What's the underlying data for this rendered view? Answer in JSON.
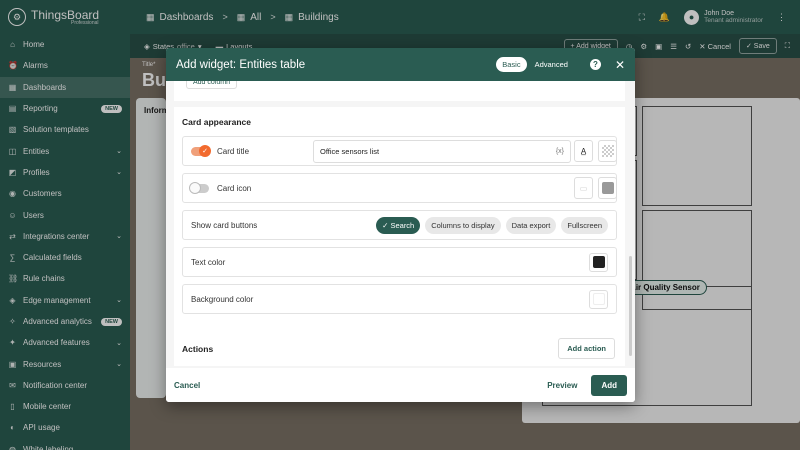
{
  "app": {
    "name": "ThingsBoard",
    "edition": "Professional"
  },
  "breadcrumb": [
    {
      "label": "Dashboards",
      "icon": "dashboards-icon"
    },
    {
      "label": "All",
      "icon": "dashboards-icon"
    },
    {
      "label": "Buildings",
      "icon": "dashboards-icon"
    }
  ],
  "user": {
    "name": "John Doe",
    "role": "Tenant administrator"
  },
  "sidebar": {
    "items": [
      {
        "label": "Home",
        "icon": "home-icon"
      },
      {
        "label": "Alarms",
        "icon": "bell-icon"
      },
      {
        "label": "Dashboards",
        "icon": "dashboards-icon",
        "active": true
      },
      {
        "label": "Reporting",
        "icon": "reporting-icon",
        "badge": "NEW"
      },
      {
        "label": "Solution templates",
        "icon": "templates-icon"
      },
      {
        "label": "Entities",
        "icon": "entities-icon",
        "expandable": true
      },
      {
        "label": "Profiles",
        "icon": "profiles-icon",
        "expandable": true
      },
      {
        "label": "Customers",
        "icon": "customers-icon"
      },
      {
        "label": "Users",
        "icon": "users-icon"
      },
      {
        "label": "Integrations center",
        "icon": "integrations-icon",
        "expandable": true
      },
      {
        "label": "Calculated fields",
        "icon": "calculated-icon"
      },
      {
        "label": "Rule chains",
        "icon": "rule-chains-icon"
      },
      {
        "label": "Edge management",
        "icon": "edge-icon",
        "expandable": true
      },
      {
        "label": "Advanced analytics",
        "icon": "analytics-icon",
        "badge": "NEW"
      },
      {
        "label": "Advanced features",
        "icon": "features-icon",
        "expandable": true
      },
      {
        "label": "Resources",
        "icon": "resources-icon",
        "expandable": true
      },
      {
        "label": "Notification center",
        "icon": "notification-icon"
      },
      {
        "label": "Mobile center",
        "icon": "mobile-icon"
      },
      {
        "label": "API usage",
        "icon": "api-icon"
      },
      {
        "label": "White labeling",
        "icon": "white-label-icon"
      }
    ]
  },
  "toolbar": {
    "states_label": "States",
    "states_value": "office",
    "layouts_label": "Layouts",
    "add_widget_label": "+ Add widget",
    "cancel_label": "Cancel",
    "save_label": "Save"
  },
  "dashboard": {
    "title_label": "Title*",
    "title": "Bui",
    "info_label": "Inform",
    "sensor_tag": "r Air Quality Sensor"
  },
  "dialog": {
    "title_prefix": "Add widget:",
    "title_name": "Entities table",
    "mode_basic": "Basic",
    "mode_advanced": "Advanced",
    "partial_button": "Add column",
    "card_appearance_title": "Card appearance",
    "card_title_label": "Card title",
    "card_title_value": "Office sensors list",
    "var_icon_text": "{x}",
    "card_icon_label": "Card icon",
    "show_buttons_label": "Show card buttons",
    "buttons": [
      {
        "label": "Search",
        "selected": true
      },
      {
        "label": "Columns to display",
        "selected": false
      },
      {
        "label": "Data export",
        "selected": false
      },
      {
        "label": "Fullscreen",
        "selected": false
      }
    ],
    "text_color_label": "Text color",
    "text_color": "#222222",
    "background_color_label": "Background color",
    "background_color": "#ffffff",
    "actions_title": "Actions",
    "add_action_label": "Add action",
    "cancel_label": "Cancel",
    "preview_label": "Preview",
    "add_label": "Add"
  },
  "colors": {
    "primary": "#2a5c52",
    "accent": "#f26a2e"
  }
}
